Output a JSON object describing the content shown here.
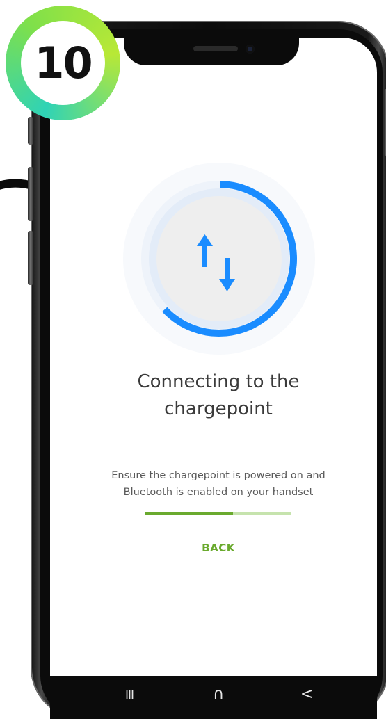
{
  "step_badge": {
    "number": "10"
  },
  "screen": {
    "title_line1": "Connecting to the",
    "title_line2": "chargepoint",
    "subtitle_line1": "Ensure the chargepoint is powered on and",
    "subtitle_line2": "Bluetooth is enabled on your handset",
    "progress_fraction": 0.6,
    "back_label": "BACK",
    "icon": "transfer-arrows-icon"
  },
  "nav_bar": {
    "recents": "III",
    "home": "∩",
    "back": "<"
  },
  "colors": {
    "accent_blue": "#1a8cff",
    "accent_green": "#6aaa2e",
    "progress_track": "#c6e3ad",
    "badge_gradient": [
      "#2fd3b6",
      "#b8e836"
    ]
  }
}
